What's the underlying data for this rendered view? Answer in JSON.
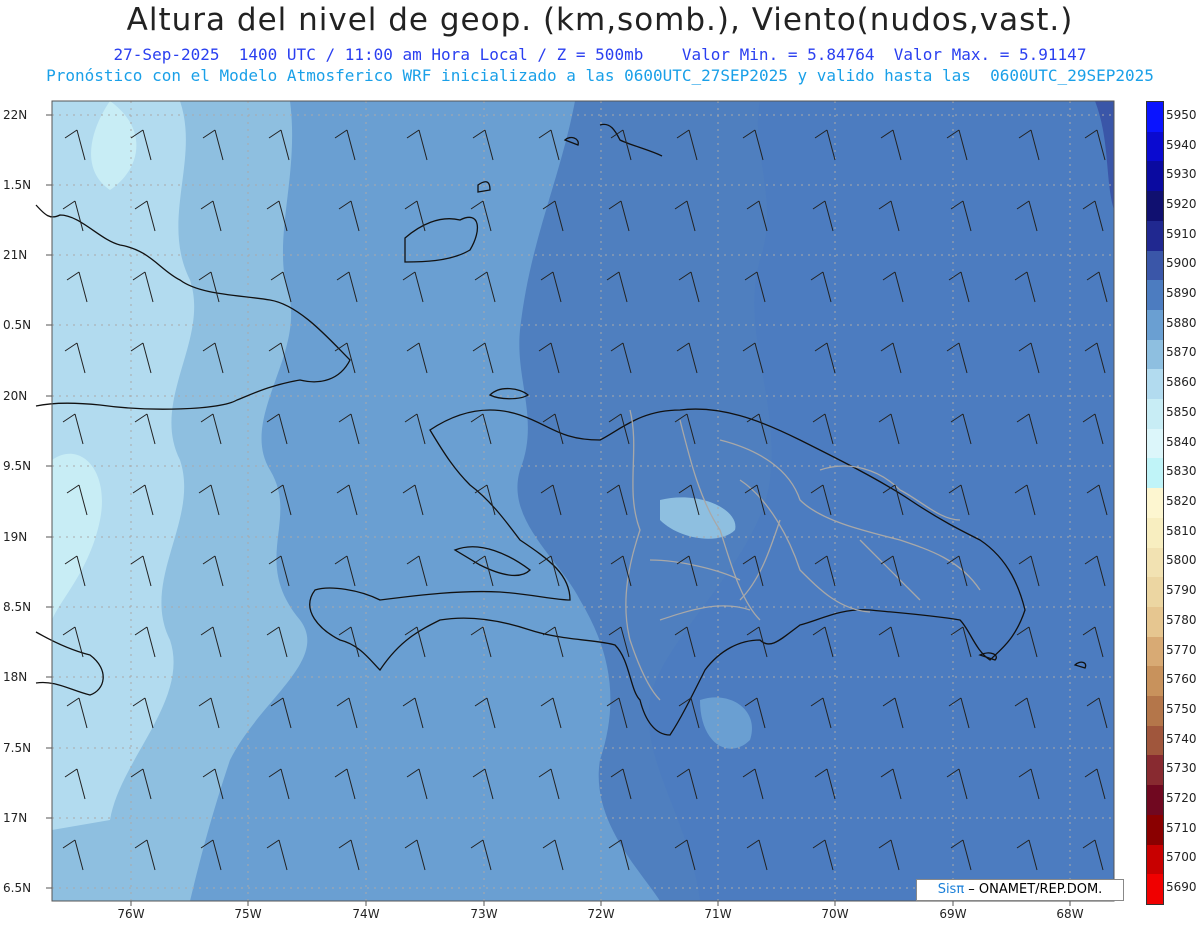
{
  "title": "Altura del nivel de geop. (km,somb.), Viento(nudos,vast.)",
  "subtitle_line1": "27-Sep-2025  1400 UTC / 11:00 am Hora Local / Z = 500mb    Valor Min. = 5.84764  Valor Max. = 5.91147",
  "subtitle_line2": "Pronóstico con el Modelo Atmosferico WRF inicializado a las 0600UTC_27SEP2025 y valido hasta las  0600UTC_29SEP2025",
  "axes": {
    "lat_labels": [
      "22N",
      "1.5N",
      "21N",
      "0.5N",
      "20N",
      "9.5N",
      "19N",
      "8.5N",
      "18N",
      "7.5N",
      "17N",
      "6.5N"
    ],
    "lon_labels": [
      "76W",
      "75W",
      "74W",
      "73W",
      "72W",
      "71W",
      "70W",
      "69W",
      "68W"
    ]
  },
  "colorbar": {
    "labels": [
      "5950",
      "5940",
      "5930",
      "5920",
      "5910",
      "5900",
      "5890",
      "5880",
      "5870",
      "5860",
      "5850",
      "5840",
      "5830",
      "5820",
      "5810",
      "5800",
      "5790",
      "5780",
      "5770",
      "5760",
      "5750",
      "5740",
      "5730",
      "5720",
      "5710",
      "5700",
      "5690"
    ],
    "colors": [
      "#0a14ff",
      "#0a0ad0",
      "#0a0aa0",
      "#101070",
      "#202890",
      "#3a56a8",
      "#4c7cc0",
      "#6a9fd2",
      "#8ebfe0",
      "#b2dbef",
      "#c8edf5",
      "#dcf6fa",
      "#c0f4f8",
      "#fdf6d0",
      "#f8eec0",
      "#f2e2b2",
      "#ecd6a2",
      "#e6c690",
      "#d8aa74",
      "#c8925c",
      "#b4764a",
      "#a0563c",
      "#882a30",
      "#700820",
      "#8a0000",
      "#c80000",
      "#f00000"
    ]
  },
  "credit": {
    "brand": "Sisπ",
    "org": " – ONAMET/REP.DOM."
  }
}
